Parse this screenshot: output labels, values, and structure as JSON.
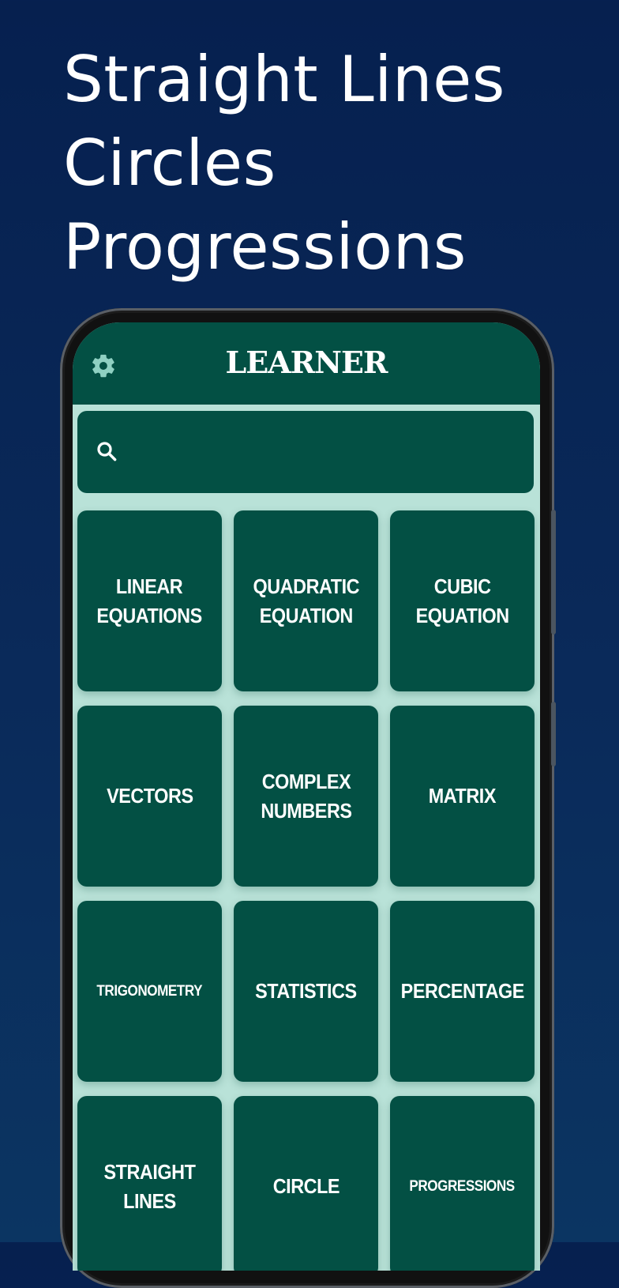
{
  "headline": {
    "lines": [
      "Straight Lines",
      "Circles",
      "Progressions"
    ]
  },
  "app": {
    "title": "LEARNER",
    "settings_icon": "gear-icon",
    "search": {
      "icon": "search-icon",
      "placeholder": "",
      "value": ""
    }
  },
  "colors": {
    "background": "#06204f",
    "app_primary": "#035044",
    "screen_bg": "#b9e2d8"
  },
  "topics": [
    {
      "label": "LINEAR\nEQUATIONS",
      "size": "normal"
    },
    {
      "label": "QUADRATIC\nEQUATION",
      "size": "normal"
    },
    {
      "label": "CUBIC\nEQUATION",
      "size": "normal"
    },
    {
      "label": "VECTORS",
      "size": "normal"
    },
    {
      "label": "COMPLEX\nNUMBERS",
      "size": "normal"
    },
    {
      "label": "MATRIX",
      "size": "normal"
    },
    {
      "label": "TRIGONOMETRY",
      "size": "small"
    },
    {
      "label": "STATISTICS",
      "size": "normal"
    },
    {
      "label": "PERCENTAGE",
      "size": "normal"
    },
    {
      "label": "STRAIGHT\nLINES",
      "size": "normal"
    },
    {
      "label": "CIRCLE",
      "size": "normal"
    },
    {
      "label": "PROGRESSIONS",
      "size": "small"
    }
  ]
}
